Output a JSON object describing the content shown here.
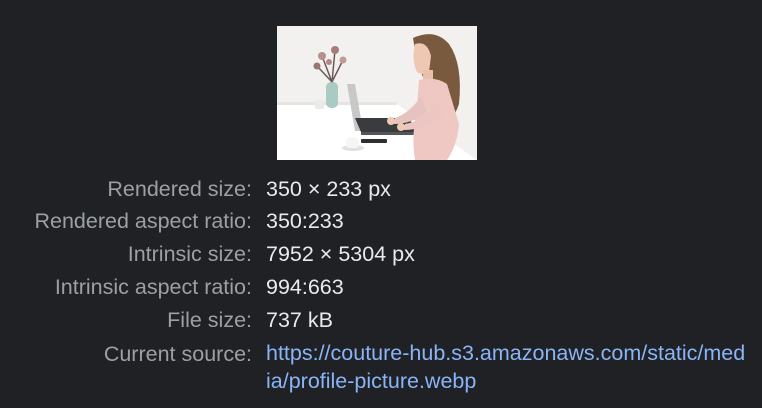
{
  "preview": {
    "alt": "Woman typing on laptop at white desk"
  },
  "info": {
    "rendered_size_label": "Rendered size:",
    "rendered_size_value": "350 × 233 px",
    "rendered_aspect_label": "Rendered aspect ratio:",
    "rendered_aspect_value": "350:233",
    "intrinsic_size_label": "Intrinsic size:",
    "intrinsic_size_value": "7952 × 5304 px",
    "intrinsic_aspect_label": "Intrinsic aspect ratio:",
    "intrinsic_aspect_value": "994:663",
    "file_size_label": "File size:",
    "file_size_value": "737 kB",
    "current_source_label": "Current source:",
    "current_source_value": "https://couture-hub.s3.amazonaws.com/static/media/profile-picture.webp"
  },
  "colors": {
    "background": "#202124",
    "label": "#9aa0a6",
    "value": "#e8eaed",
    "link": "#8ab4f8"
  }
}
